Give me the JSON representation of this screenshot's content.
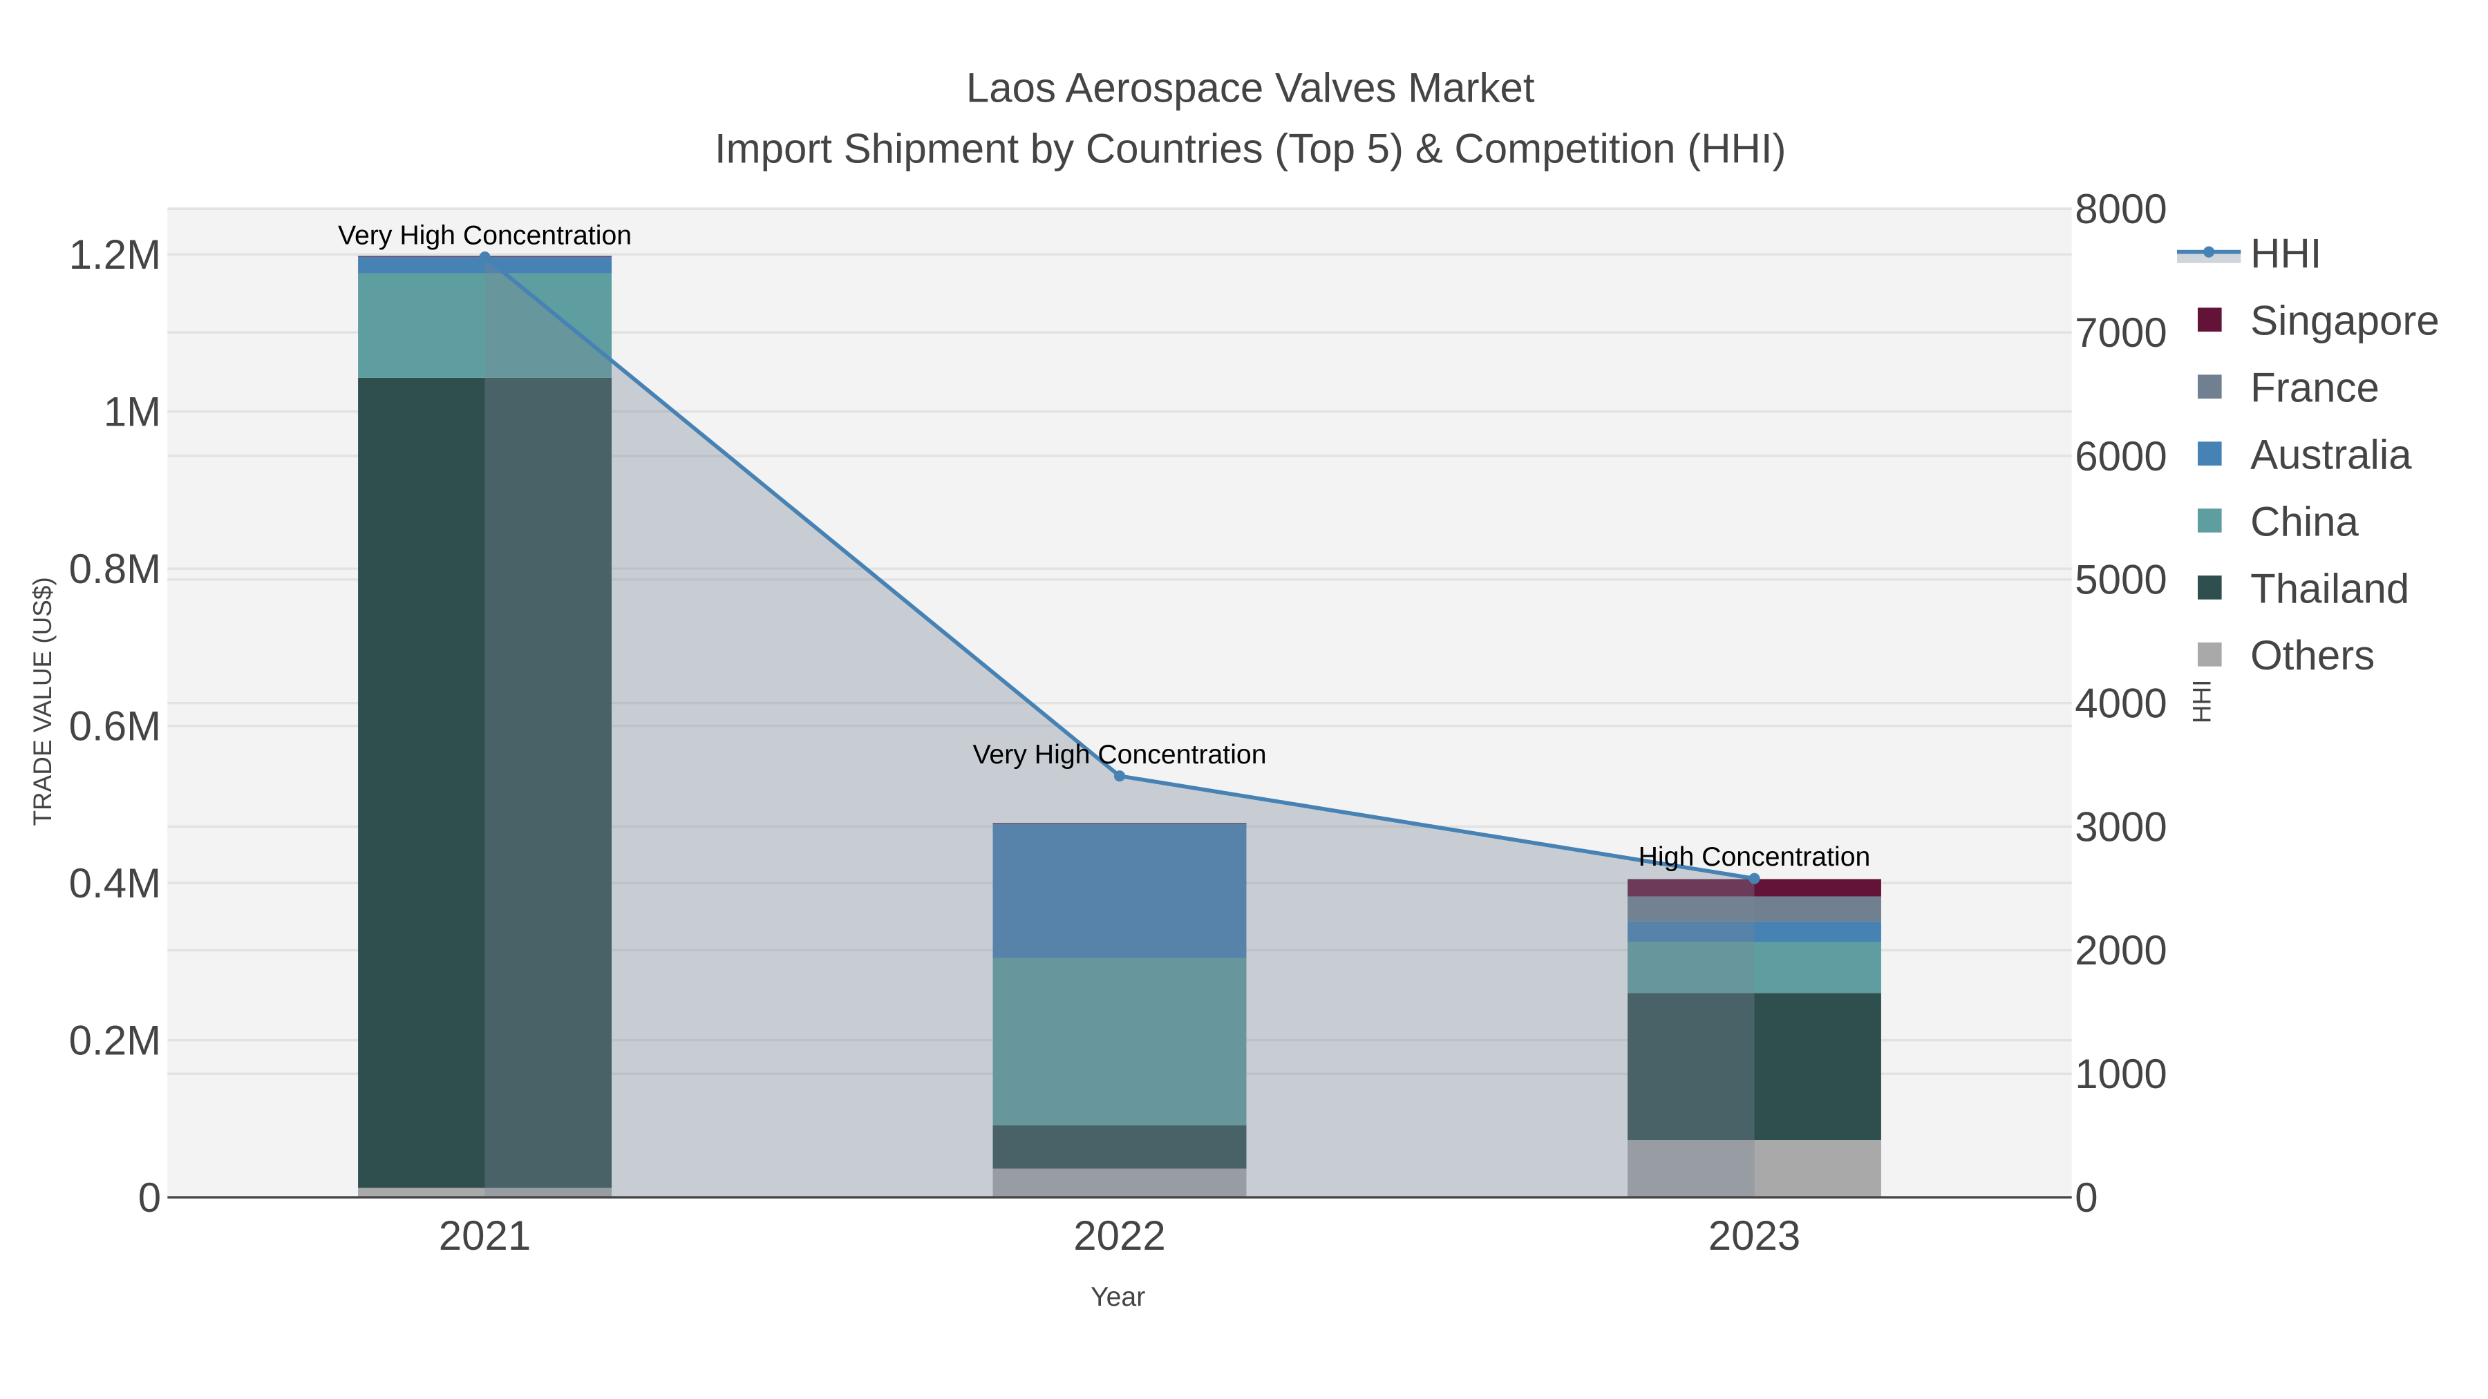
{
  "chart_data": {
    "type": "bar",
    "title": "Laos Aerospace Valves Market",
    "subtitle": "Import Shipment by Countries (Top 5) & Competition (HHI)",
    "xlabel": "Year",
    "ylabel": "TRADE VALUE (US$)",
    "y2label": "HHI",
    "categories": [
      "2021",
      "2022",
      "2023"
    ],
    "ylim": [
      0,
      1260000
    ],
    "y2lim": [
      0,
      8000
    ],
    "yticks": [
      {
        "v": 0,
        "label": "0"
      },
      {
        "v": 200000,
        "label": "0.2M"
      },
      {
        "v": 400000,
        "label": "0.4M"
      },
      {
        "v": 600000,
        "label": "0.6M"
      },
      {
        "v": 800000,
        "label": "0.8M"
      },
      {
        "v": 1000000,
        "label": "1M"
      },
      {
        "v": 1200000,
        "label": "1.2M"
      }
    ],
    "y2ticks": [
      {
        "v": 0,
        "label": "0"
      },
      {
        "v": 1000,
        "label": "1000"
      },
      {
        "v": 2000,
        "label": "2000"
      },
      {
        "v": 3000,
        "label": "3000"
      },
      {
        "v": 4000,
        "label": "4000"
      },
      {
        "v": 5000,
        "label": "5000"
      },
      {
        "v": 6000,
        "label": "6000"
      },
      {
        "v": 7000,
        "label": "7000"
      },
      {
        "v": 8000,
        "label": "8000"
      }
    ],
    "series": [
      {
        "name": "Others",
        "color": "#a9a9a9",
        "values": [
          12000,
          36500,
          73000
        ]
      },
      {
        "name": "Thailand",
        "color": "#2f4f4f",
        "values": [
          1031000,
          55000,
          187000
        ]
      },
      {
        "name": "China",
        "color": "#5f9ea0",
        "values": [
          133000,
          213000,
          65000
        ]
      },
      {
        "name": "Australia",
        "color": "#4682b4",
        "values": [
          21000,
          171000,
          26000
        ]
      },
      {
        "name": "France",
        "color": "#708090",
        "values": [
          0,
          0,
          32000
        ]
      },
      {
        "name": "Singapore",
        "color": "#641338",
        "values": [
          1000,
          1000,
          22000
        ]
      }
    ],
    "hhi": {
      "name": "HHI",
      "color": "#4682b4",
      "values": [
        7610,
        3410,
        2580
      ],
      "annotations": [
        "Very High Concentration",
        "Very High Concentration",
        "High Concentration"
      ]
    },
    "legend": {
      "placement": "right",
      "items": [
        "HHI",
        "Singapore",
        "France",
        "Australia",
        "China",
        "Thailand",
        "Others"
      ]
    },
    "grid": true
  }
}
